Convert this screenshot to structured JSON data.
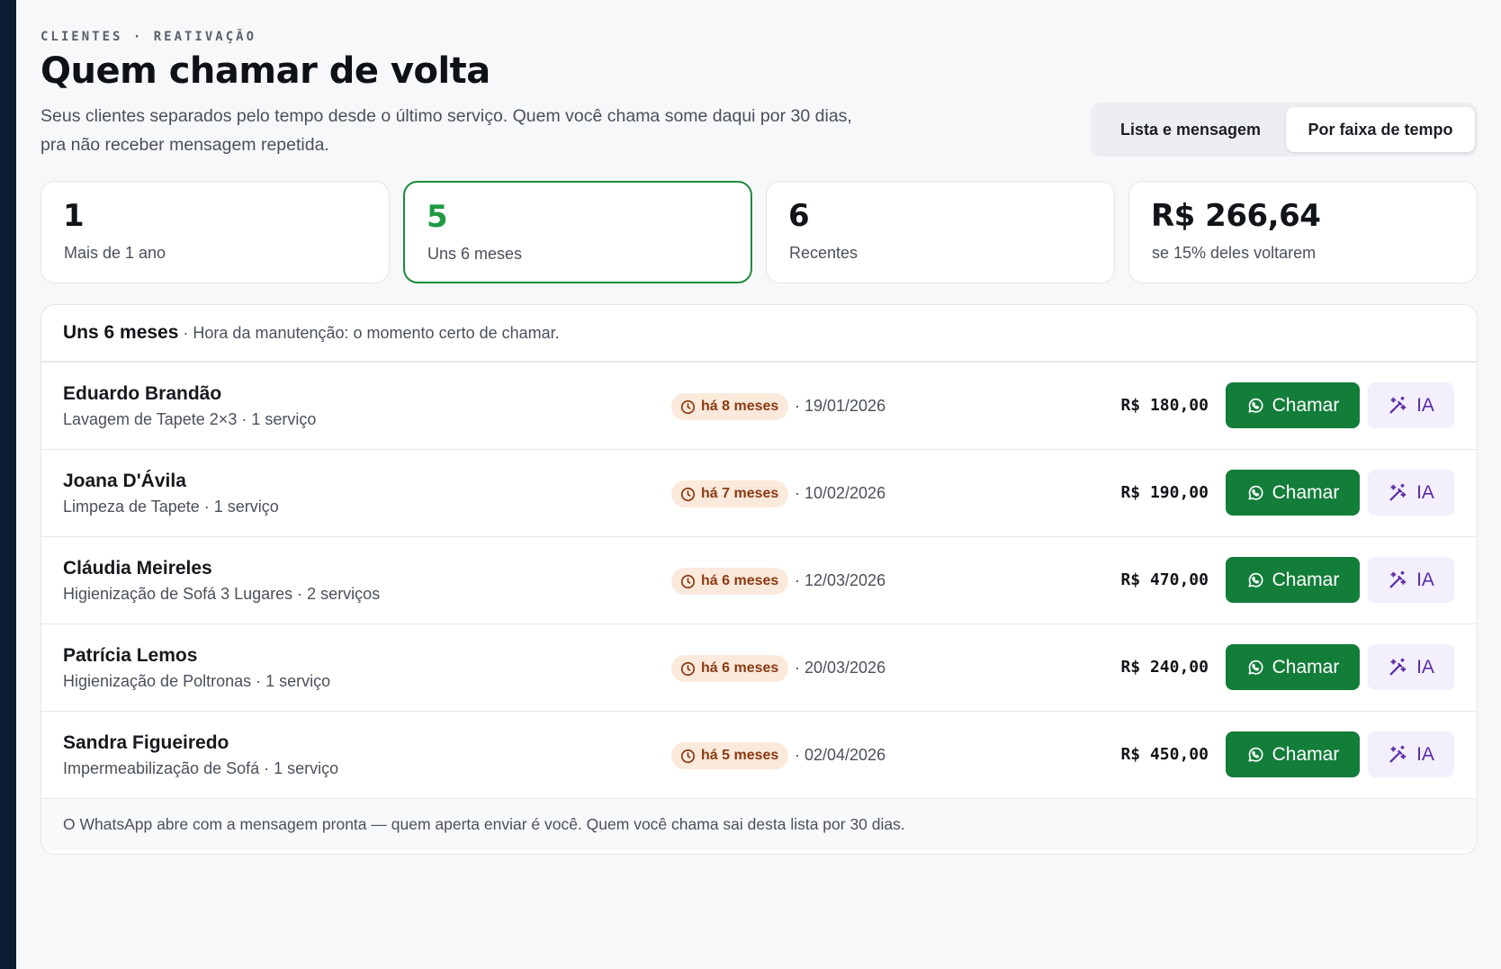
{
  "header": {
    "eyebrow": "CLIENTES · REATIVAÇÃO",
    "title": "Quem chamar de volta",
    "subtitle": "Seus clientes separados pelo tempo desde o último serviço. Quem você chama some daqui por 30 dias, pra não receber mensagem repetida."
  },
  "view_toggle": {
    "options": [
      "Lista e mensagem",
      "Por faixa de tempo"
    ],
    "selected": "Por faixa de tempo"
  },
  "stats": [
    {
      "value": "1",
      "label": "Mais de 1 ano"
    },
    {
      "value": "5",
      "label": "Uns 6 meses",
      "active": true
    },
    {
      "value": "6",
      "label": "Recentes"
    },
    {
      "value": "R$ 266,64",
      "label": "se 15% deles voltarem"
    }
  ],
  "panel": {
    "bucket_title": "Uns 6 meses",
    "bucket_note": "· Hora da manutenção: o momento certo de chamar.",
    "call_label": "Chamar",
    "ai_label": "IA",
    "rows": [
      {
        "name": "Eduardo Brandão",
        "detail": "Lavagem de Tapete 2×3 · 1 serviço",
        "age": "há 8 meses",
        "date": "· 19/01/2026",
        "value": "R$ 180,00"
      },
      {
        "name": "Joana D'Ávila",
        "detail": "Limpeza de Tapete · 1 serviço",
        "age": "há 7 meses",
        "date": "· 10/02/2026",
        "value": "R$ 190,00"
      },
      {
        "name": "Cláudia Meireles",
        "detail": "Higienização de Sofá 3 Lugares · 2 serviços",
        "age": "há 6 meses",
        "date": "· 12/03/2026",
        "value": "R$ 470,00"
      },
      {
        "name": "Patrícia Lemos",
        "detail": "Higienização de Poltronas · 1 serviço",
        "age": "há 6 meses",
        "date": "· 20/03/2026",
        "value": "R$ 240,00"
      },
      {
        "name": "Sandra Figueiredo",
        "detail": "Impermeabilização de Sofá · 1 serviço",
        "age": "há 5 meses",
        "date": "· 02/04/2026",
        "value": "R$ 450,00"
      }
    ],
    "footer": "O WhatsApp abre com a mensagem pronta — quem aperta enviar é você. Quem você chama sai desta lista por 30 dias."
  },
  "colors": {
    "accent_green": "#137d3a",
    "active_stat": "#1f9a45",
    "age_badge_bg": "#fbe9dc",
    "age_badge_text": "#8a3a12",
    "ai_button_text": "#5a2ca8",
    "sidebar": "#0d1b33"
  },
  "icons": {
    "age": "clock-icon",
    "call": "whatsapp-icon",
    "ai": "magic-wand-icon"
  }
}
